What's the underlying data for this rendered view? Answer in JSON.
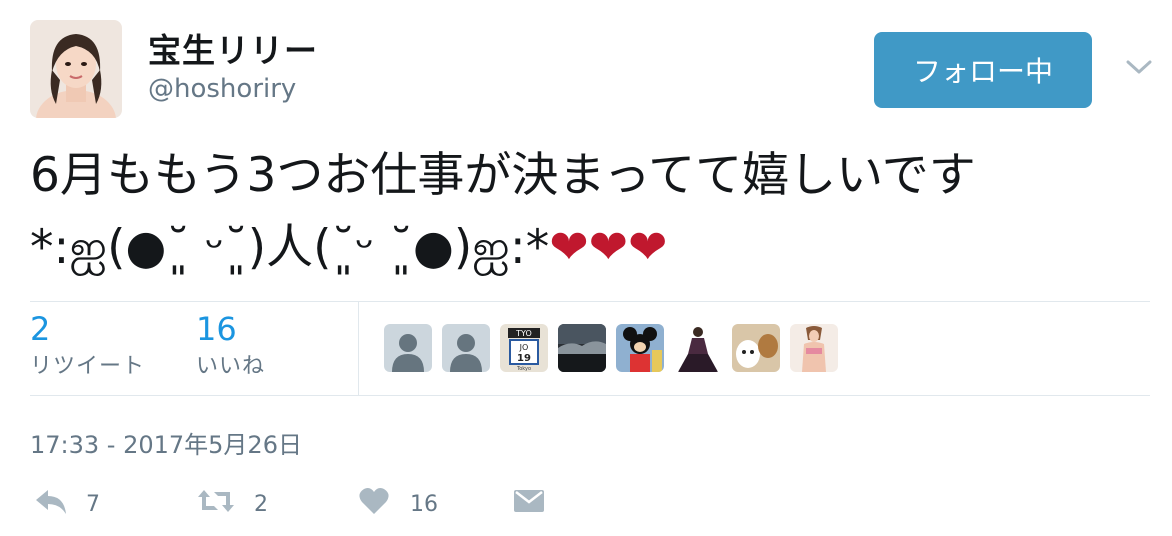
{
  "user": {
    "name": "宝生リリー",
    "handle": "@hoshoriry",
    "follow_label": "フォロー中"
  },
  "tweet": {
    "line1": "6月ももう3つお仕事が決まってて嬉しいです",
    "line2_prefix": "*:ஐ(●˘͈ ᵕ˘͈)人(˘͈ᵕ ˘͈●)ஐ:*",
    "hearts": "❤❤❤"
  },
  "stats": {
    "retweets_count": "2",
    "retweets_label": "リツイート",
    "likes_count": "16",
    "likes_label": "いいね"
  },
  "likers": [
    {
      "icon": "default-user-icon"
    },
    {
      "icon": "default-user-icon"
    },
    {
      "icon": "calendar-tile-icon",
      "badge": "TYO",
      "num_top": "JO",
      "num_bottom": "19",
      "caption": "Tokyo"
    },
    {
      "icon": "landscape-photo"
    },
    {
      "icon": "mouse-character-photo"
    },
    {
      "icon": "dress-figure-photo"
    },
    {
      "icon": "dogs-photo"
    },
    {
      "icon": "person-photo"
    }
  ],
  "timestamp": "17:33 - 2017年5月26日",
  "actions": {
    "reply_count": "7",
    "retweet_count": "2",
    "like_count": "16"
  },
  "colors": {
    "accent": "#4099c6",
    "link": "#1b95e0",
    "muted": "#657786",
    "heart": "#c0182e",
    "icon": "#aab8c2"
  }
}
